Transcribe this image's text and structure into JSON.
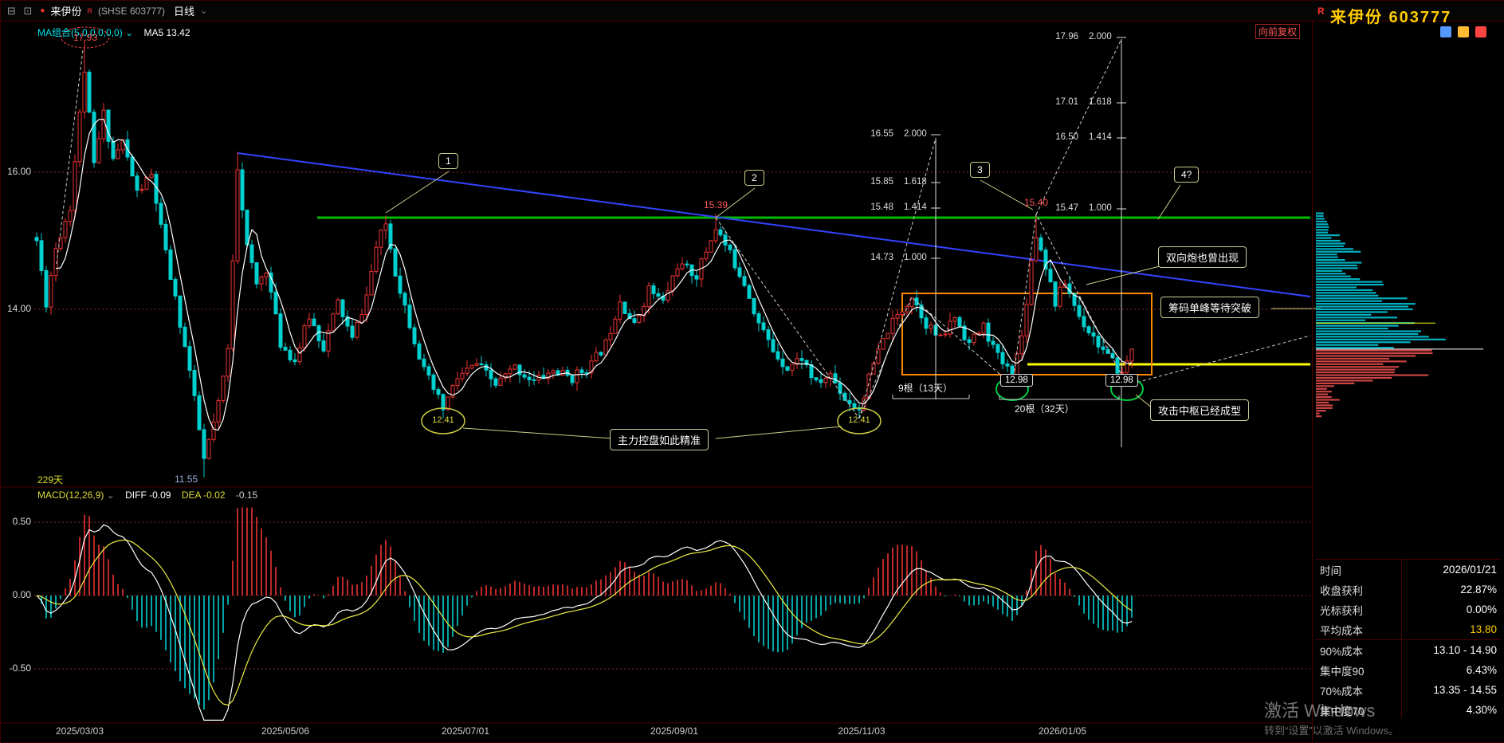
{
  "titlebar": {
    "window_buttons": "⊟ ⊡",
    "stock_name": "来伊份",
    "reg_mark": "R",
    "exchange": "(SHSE 603777)",
    "period": "日线",
    "caret": "⌄"
  },
  "main_chart": {
    "ma_label": "MA组合(5,0,0,0,0,0)",
    "ma_caret": "⌄",
    "ma5_value": "MA5 13.42",
    "adjust_label": "向前复权",
    "days_label": "229天",
    "price_ticks": [
      "16.00",
      "14.00"
    ],
    "high_label": "17.93",
    "low_label": "11.55"
  },
  "macd_panel": {
    "label": "MACD(12,26,9)",
    "caret": "⌄",
    "diff": "DIFF -0.09",
    "dea": "DEA -0.02",
    "value": "-0.15",
    "ticks": [
      "0.50",
      "0.00",
      "-0.50"
    ]
  },
  "annotations": {
    "num_boxes": [
      "1",
      "2",
      "3",
      "4?"
    ],
    "callout_double_cannon": "双向炮也曾出现",
    "callout_chip_peak": "筹码单峰等待突破",
    "callout_attack_pivot": "攻击中枢已经成型",
    "callout_main_force": "主力控盘如此精准",
    "peak1": "15.39",
    "peak2": "15.40",
    "low1": "12.41",
    "low2": "12.41",
    "pivot1": "12.98",
    "pivot2": "12.98",
    "bars_label_1": "9根（13天）",
    "bars_label_2": "20根（32天）",
    "fib_left": [
      [
        "16.55",
        "2.000"
      ],
      [
        "15.85",
        "1.618"
      ],
      [
        "15.48",
        "1.414"
      ],
      [
        "14.73",
        "1.000"
      ]
    ],
    "fib_right": [
      [
        "17.96",
        "2.000"
      ],
      [
        "17.01",
        "1.618"
      ],
      [
        "16.50",
        "1.414"
      ],
      [
        "15.47",
        "1.000"
      ]
    ]
  },
  "side_panel": {
    "reg_mark": "R",
    "title": "来伊份 603777",
    "stats": [
      {
        "label": "时间",
        "value": "2026/01/21"
      },
      {
        "label": "收盘获利",
        "value": "22.87%"
      },
      {
        "label": "光标获利",
        "value": "0.00%"
      },
      {
        "label": "平均成本",
        "value": "13.80"
      },
      {
        "label": "90%成本",
        "value": "13.10 - 14.90"
      },
      {
        "label": "集中度90",
        "value": "6.43%"
      },
      {
        "label": "70%成本",
        "value": "13.35 - 14.55"
      },
      {
        "label": "集中度70",
        "value": "4.30%"
      }
    ]
  },
  "watermark": {
    "line1": "激活 Windows",
    "line2": "转到“设置”以激活 Windows。"
  },
  "colors": {
    "up": "#ee3333",
    "down": "#00d0d0",
    "ma5": "#ffffff",
    "diff_line": "#ffffff",
    "dea_line": "#eeee44",
    "green_line": "#00bb00",
    "blue_line": "#3344ff",
    "yellow_line": "#ffff00",
    "orange_box": "#ff8800",
    "profit_chip": "#cc4444",
    "trapped_chip": "#00b0c0",
    "grid": "#8a2a2a"
  },
  "chart_data": {
    "type": "candlestick",
    "title": "来伊份 603777 日线",
    "days": 230,
    "ylim": [
      11.0,
      18.2
    ],
    "gridlines": [
      16.0,
      14.0
    ],
    "last_close": 13.42,
    "ma5_last": 13.42,
    "dates": [
      "2025/03/03",
      "2025/05/06",
      "2025/07/01",
      "2025/09/01",
      "2025/11/03",
      "2026/01/05"
    ],
    "key_levels": {
      "high": 17.93,
      "low": 11.55,
      "swing_lows": [
        12.41,
        12.41,
        12.98,
        12.98
      ],
      "swing_highs": [
        15.39,
        15.4
      ],
      "green_resistance": 15.34,
      "yellow_support": 13.2
    },
    "price_anchors": [
      [
        0,
        15.0
      ],
      [
        2,
        14.1
      ],
      [
        4,
        14.9
      ],
      [
        7,
        15.5
      ],
      [
        10,
        17.5
      ],
      [
        12,
        16.1
      ],
      [
        14,
        16.85
      ],
      [
        16,
        16.2
      ],
      [
        18,
        16.45
      ],
      [
        21,
        15.7
      ],
      [
        24,
        15.95
      ],
      [
        27,
        14.8
      ],
      [
        30,
        13.8
      ],
      [
        32,
        13.1
      ],
      [
        35,
        11.8
      ],
      [
        38,
        12.6
      ],
      [
        40,
        13.4
      ],
      [
        42,
        16.1
      ],
      [
        44,
        14.9
      ],
      [
        46,
        14.35
      ],
      [
        48,
        14.6
      ],
      [
        51,
        13.5
      ],
      [
        54,
        13.25
      ],
      [
        57,
        13.9
      ],
      [
        60,
        13.45
      ],
      [
        63,
        14.1
      ],
      [
        66,
        13.55
      ],
      [
        69,
        14.2
      ],
      [
        71,
        14.9
      ],
      [
        73,
        15.25
      ],
      [
        75,
        14.55
      ],
      [
        78,
        13.8
      ],
      [
        81,
        13.1
      ],
      [
        85,
        12.55
      ],
      [
        88,
        13.0
      ],
      [
        92,
        13.2
      ],
      [
        96,
        12.9
      ],
      [
        100,
        13.15
      ],
      [
        104,
        12.95
      ],
      [
        108,
        13.1
      ],
      [
        112,
        13.0
      ],
      [
        116,
        13.2
      ],
      [
        119,
        13.5
      ],
      [
        122,
        14.15
      ],
      [
        125,
        13.75
      ],
      [
        128,
        14.3
      ],
      [
        131,
        14.1
      ],
      [
        134,
        14.65
      ],
      [
        138,
        14.5
      ],
      [
        142,
        15.2
      ],
      [
        145,
        14.8
      ],
      [
        148,
        14.4
      ],
      [
        151,
        13.8
      ],
      [
        154,
        13.4
      ],
      [
        157,
        13.15
      ],
      [
        160,
        13.3
      ],
      [
        163,
        12.9
      ],
      [
        166,
        13.05
      ],
      [
        169,
        12.7
      ],
      [
        172,
        12.55
      ],
      [
        175,
        13.2
      ],
      [
        178,
        13.7
      ],
      [
        183,
        14.2
      ],
      [
        186,
        13.8
      ],
      [
        189,
        13.55
      ],
      [
        192,
        13.9
      ],
      [
        195,
        13.5
      ],
      [
        198,
        13.75
      ],
      [
        201,
        13.3
      ],
      [
        204,
        13.05
      ],
      [
        206,
        13.6
      ],
      [
        208,
        14.7
      ],
      [
        209,
        15.1
      ],
      [
        211,
        14.65
      ],
      [
        213,
        14.1
      ],
      [
        215,
        14.4
      ],
      [
        218,
        13.9
      ],
      [
        221,
        13.6
      ],
      [
        224,
        13.3
      ],
      [
        227,
        13.05
      ],
      [
        229,
        13.42
      ]
    ],
    "pin_highs": {
      "10": 17.93,
      "42": 16.3,
      "142": 15.39,
      "209": 15.4
    },
    "pin_lows": {
      "35": 11.55,
      "85": 12.41,
      "172": 12.41,
      "204": 12.98,
      "228": 12.98
    },
    "macd": {
      "diff_last": -0.09,
      "dea_last": -0.02,
      "bar_last": -0.15,
      "ticks": [
        0.5,
        0,
        -0.5
      ]
    },
    "chip_distribution": {
      "avg_cost": 13.8,
      "close": 13.42,
      "profit_pct": 22.87,
      "cost90": [
        13.1,
        14.9
      ],
      "conc90": 6.43,
      "cost70": [
        13.35,
        14.55
      ],
      "conc70": 4.3
    }
  }
}
